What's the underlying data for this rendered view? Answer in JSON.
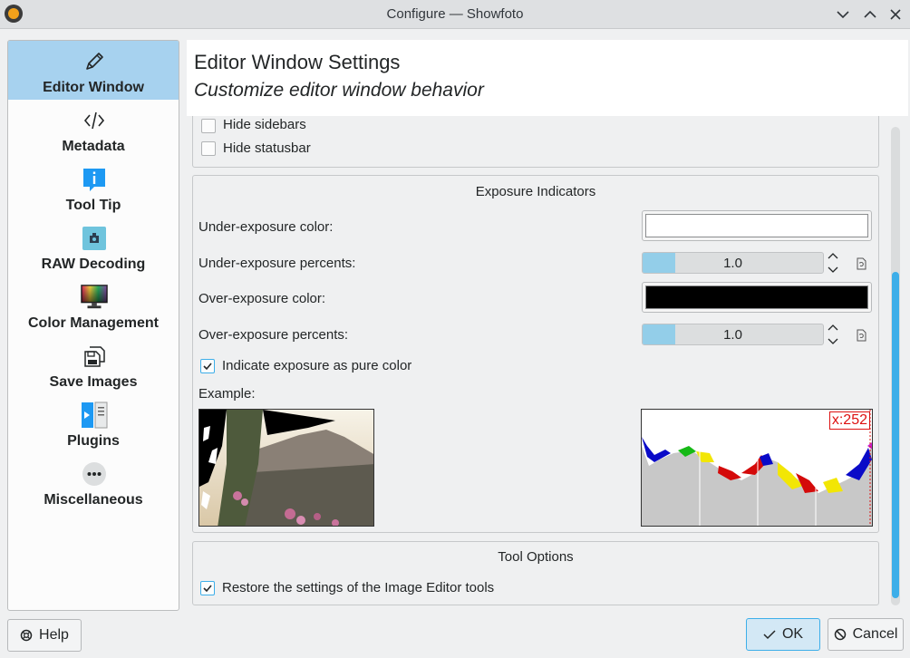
{
  "window": {
    "title": "Configure — Showfoto"
  },
  "sidebar": {
    "items": [
      {
        "label": "Editor Window",
        "icon": "pencil-icon"
      },
      {
        "label": "Metadata",
        "icon": "code-icon"
      },
      {
        "label": "Tool Tip",
        "icon": "info-icon"
      },
      {
        "label": "RAW Decoding",
        "icon": "raw-camera-icon"
      },
      {
        "label": "Color Management",
        "icon": "monitor-color-icon"
      },
      {
        "label": "Save Images",
        "icon": "save-images-icon"
      },
      {
        "label": "Plugins",
        "icon": "plugins-icon"
      },
      {
        "label": "Miscellaneous",
        "icon": "more-icon"
      }
    ],
    "active_index": 0
  },
  "header": {
    "title": "Editor Window Settings",
    "subtitle": "Customize editor window behavior"
  },
  "layout_group": {
    "hide_sidebars": {
      "label": "Hide sidebars",
      "checked": false
    },
    "hide_statusbar": {
      "label": "Hide statusbar",
      "checked": false
    }
  },
  "exposure": {
    "title": "Exposure Indicators",
    "under_color_label": "Under-exposure color:",
    "under_color": "#ffffff",
    "under_percent_label": "Under-exposure percents:",
    "under_percent": "1.0",
    "over_color_label": "Over-exposure color:",
    "over_color": "#000000",
    "over_percent_label": "Over-exposure percents:",
    "over_percent": "1.0",
    "pure_color": {
      "label": "Indicate exposure as pure color",
      "checked": true
    },
    "example_label": "Example:",
    "histogram_marker": "x:252"
  },
  "tool_options": {
    "title": "Tool Options",
    "restore": {
      "label": "Restore the settings of the Image Editor tools",
      "checked": true
    }
  },
  "buttons": {
    "help": "Help",
    "ok": "OK",
    "cancel": "Cancel"
  },
  "colors": {
    "accent": "#3daee9",
    "sidebar_active": "#a7d2ef",
    "spin_fill": "#93cee9"
  }
}
